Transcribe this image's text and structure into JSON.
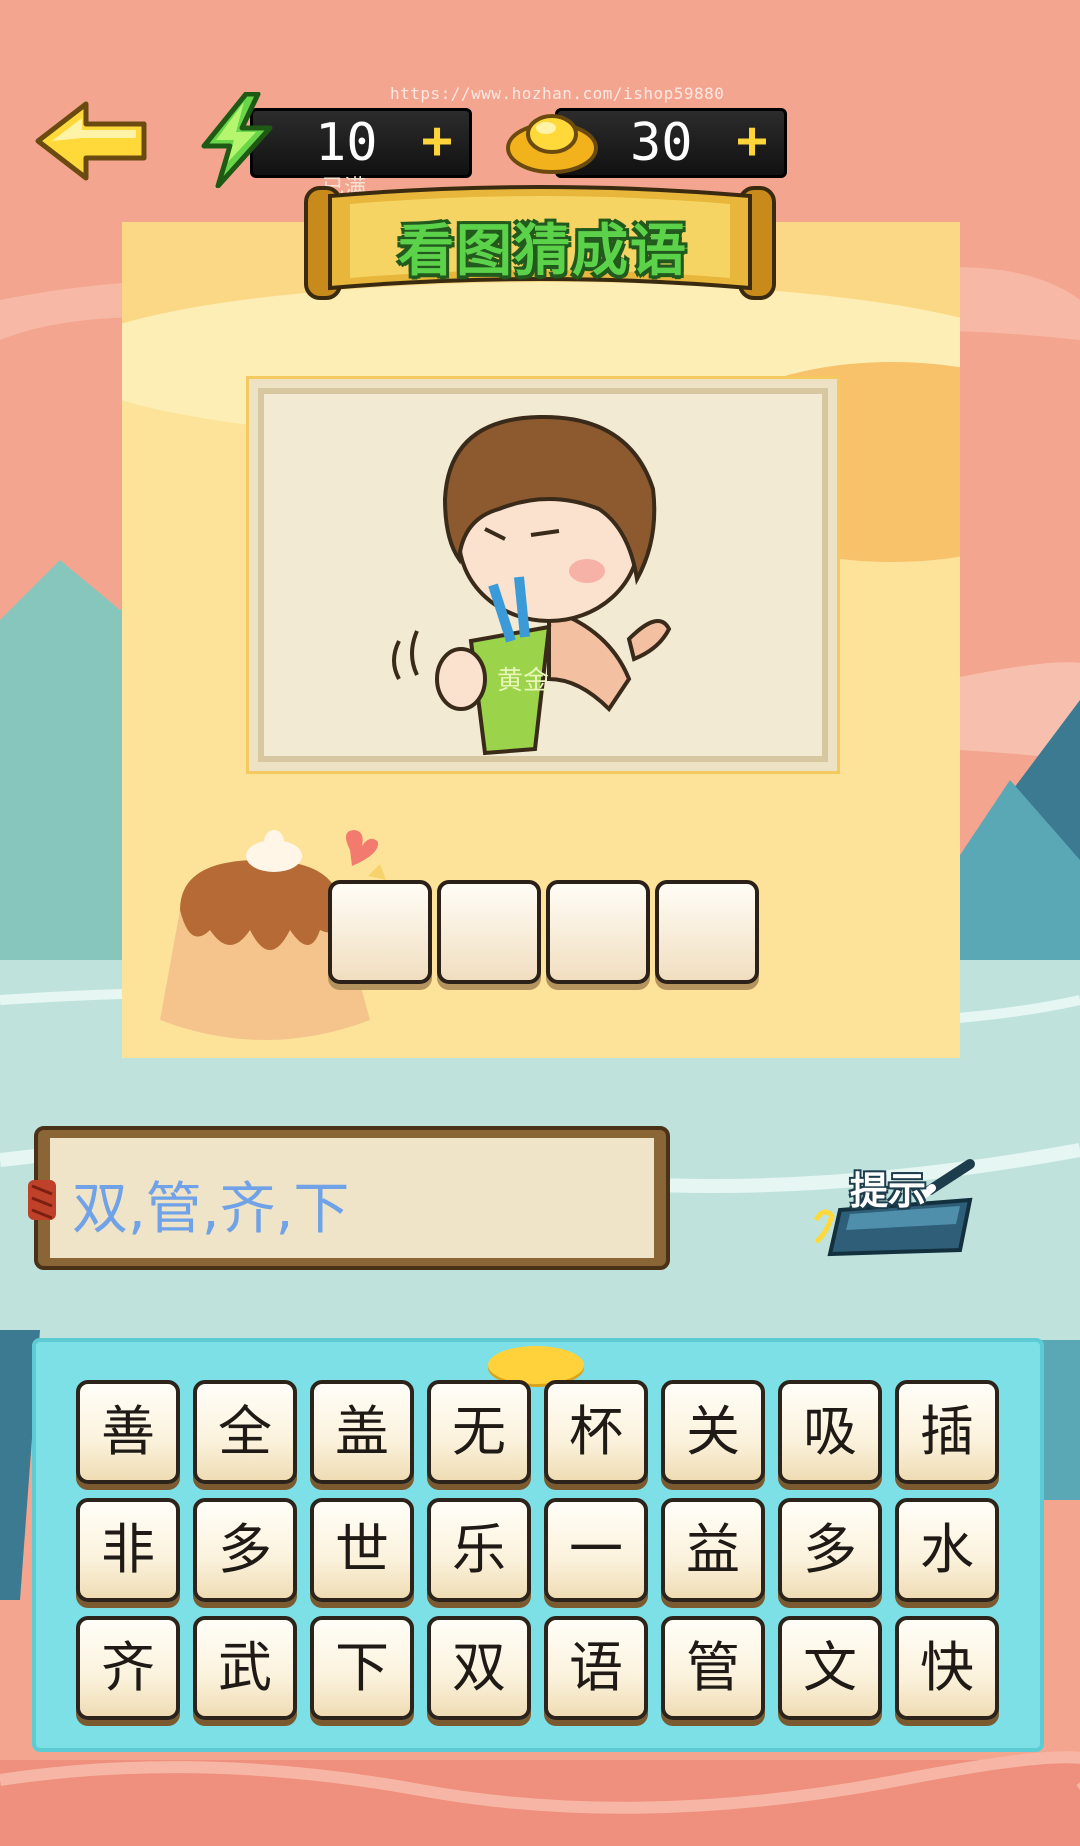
{
  "header": {
    "back_icon": "arrow-left-icon",
    "energy": {
      "icon": "lightning-icon",
      "value": "10",
      "plus": "+",
      "status": "已满"
    },
    "coins": {
      "icon": "gold-ingot-icon",
      "value": "30",
      "plus": "+"
    },
    "watermark": "https://www.hozhan.com/ishop59880"
  },
  "title": "看图猜成语",
  "answer": {
    "slots": [
      "",
      "",
      "",
      ""
    ]
  },
  "hint": {
    "text": "双,管,齐,下",
    "button_label": "提示"
  },
  "keyboard": {
    "rows": [
      [
        "善",
        "全",
        "盖",
        "无",
        "杯",
        "关",
        "吸",
        "插"
      ],
      [
        "非",
        "多",
        "世",
        "乐",
        "一",
        "益",
        "多",
        "水"
      ],
      [
        "齐",
        "武",
        "下",
        "双",
        "语",
        "管",
        "文",
        "快"
      ]
    ]
  },
  "colors": {
    "accent_green": "#5cd24a",
    "keyboard_bg": "#7ce0e6",
    "hint_text": "#6fa2e6"
  }
}
